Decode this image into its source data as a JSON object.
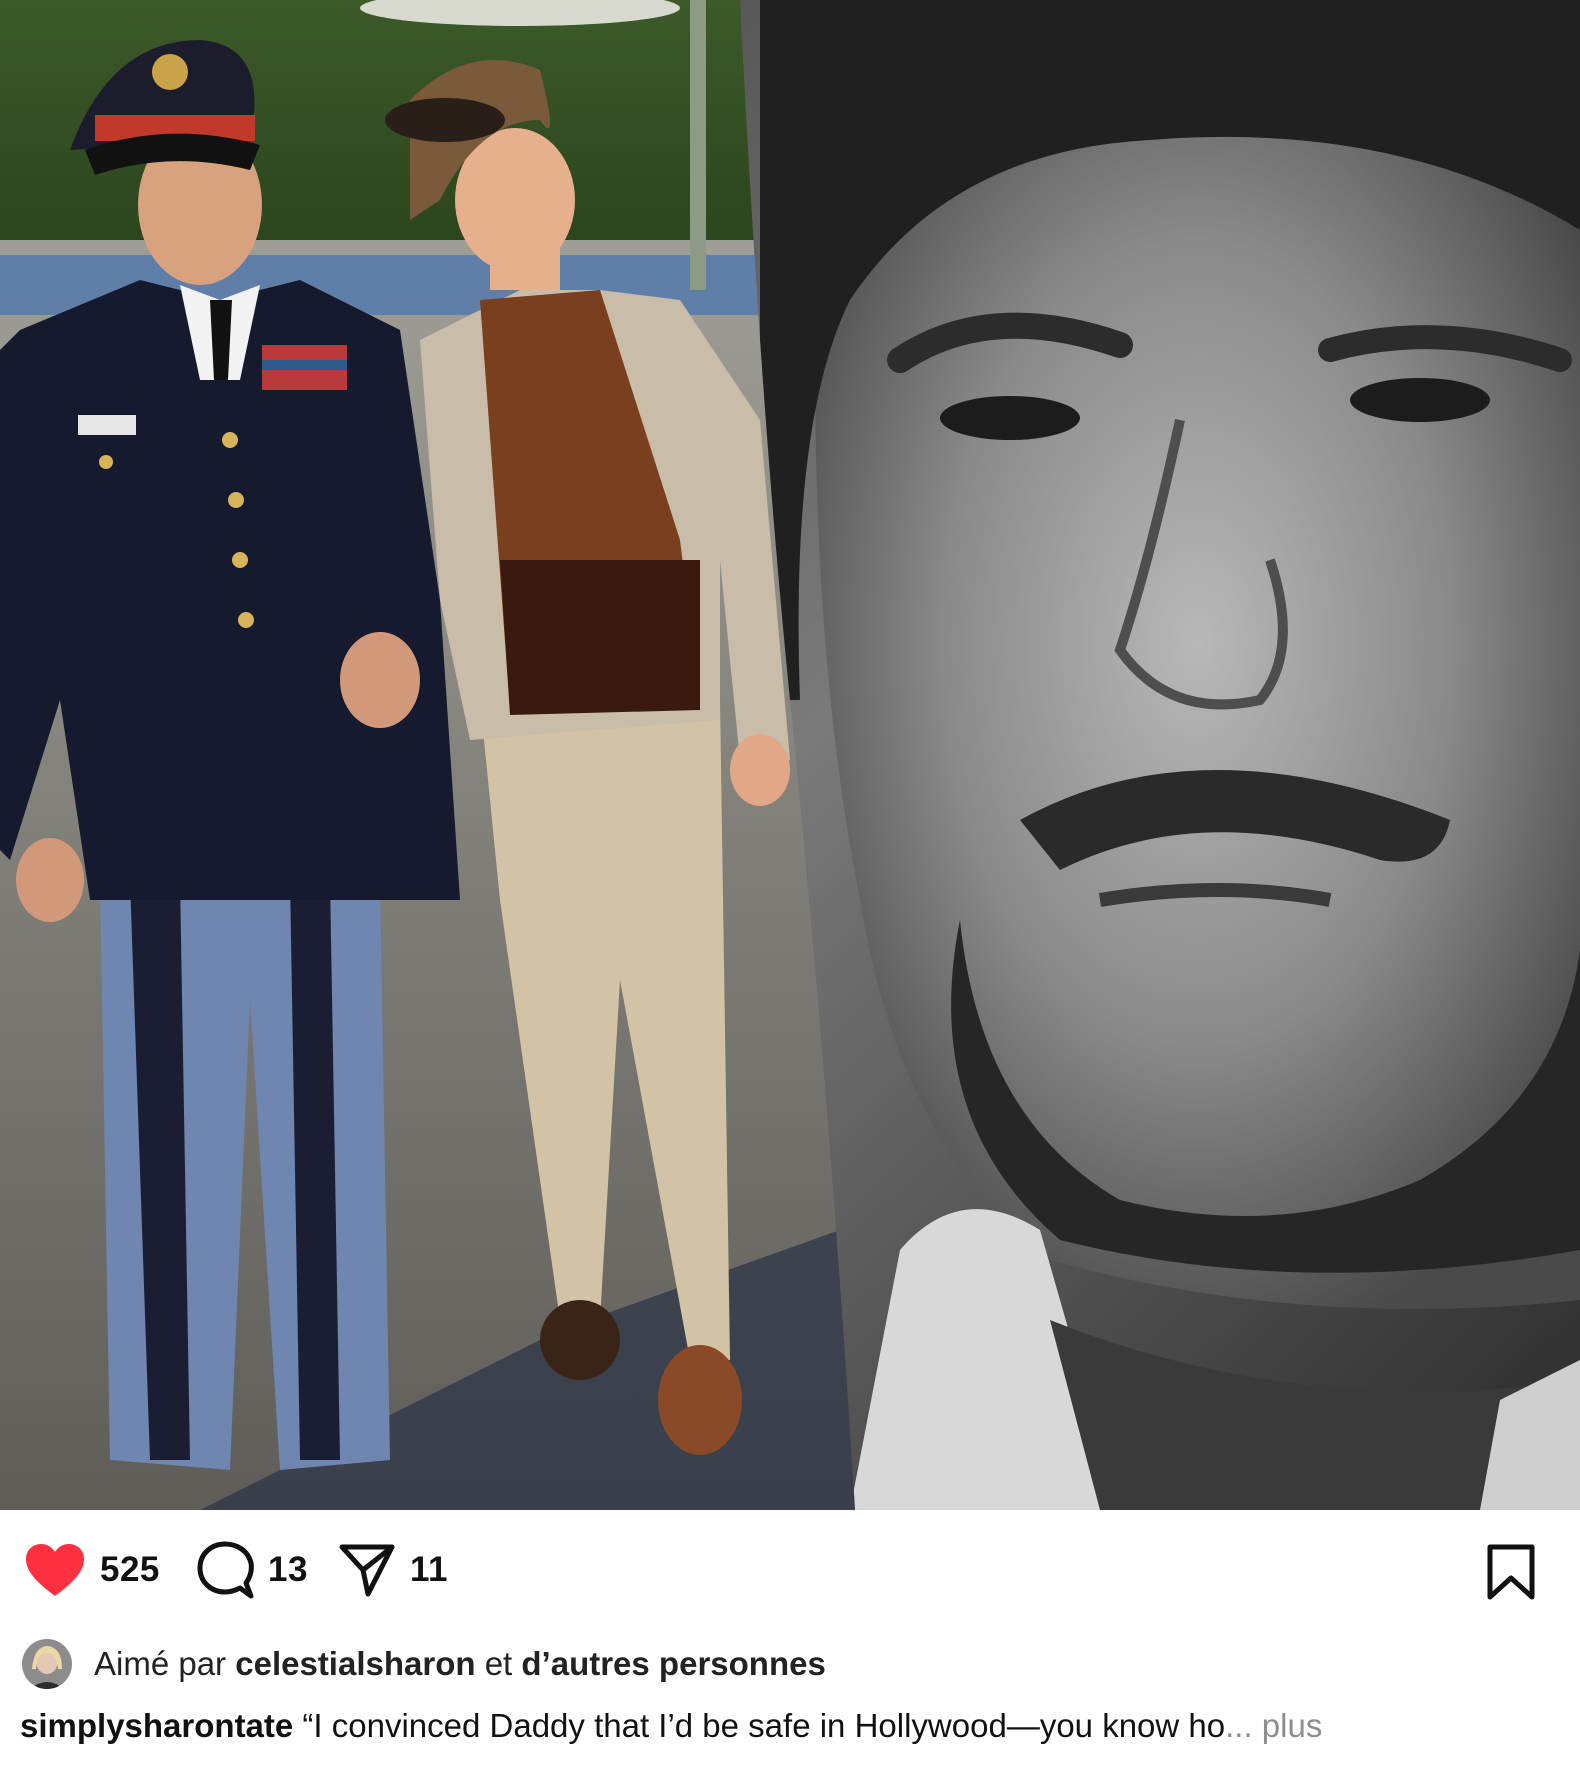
{
  "post": {
    "like_count": "525",
    "comment_count": "13",
    "share_count": "11",
    "liked": true
  },
  "liked_by": {
    "prefix": "Aimé par",
    "username": "celestialsharon",
    "connector": "et",
    "others": "d’autres personnes"
  },
  "caption": {
    "username": "simplysharontate",
    "text": "“I convinced Daddy that I’d be safe in Hollywood—you know ho",
    "ellipsis": "...",
    "more_label": "plus"
  },
  "icons": {
    "like": "heart-icon",
    "comment": "comment-bubble-icon",
    "share": "paper-plane-icon",
    "bookmark": "bookmark-icon"
  },
  "colors": {
    "like_red": "#ff3040",
    "text": "#111111",
    "muted": "#8e8e8e"
  }
}
